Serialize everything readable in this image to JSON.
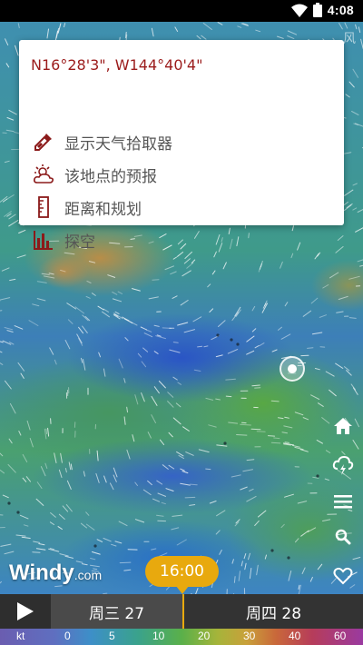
{
  "status": {
    "time": "4:08"
  },
  "map": {
    "corner_label": "风"
  },
  "popup": {
    "coords": "N16°28'3\", W144°40'4\"",
    "items": [
      {
        "label": "显示天气拾取器",
        "icon": "picker-icon"
      },
      {
        "label": "该地点的预报",
        "icon": "weather-forecast-icon"
      },
      {
        "label": "距离和规划",
        "icon": "ruler-icon"
      },
      {
        "label": "探空",
        "icon": "bar-chart-icon"
      }
    ]
  },
  "logo": {
    "main": "Windy",
    "suffix": ".com"
  },
  "timeline": {
    "bubble": "16:00",
    "day1": "周三 27",
    "day2": "周四 28"
  },
  "scale": {
    "unit": "kt",
    "ticks": [
      "0",
      "5",
      "10",
      "20",
      "30",
      "40",
      "60"
    ]
  },
  "colors": {
    "accent": "#e8a90e",
    "popup_text": "#9b1b1b"
  }
}
